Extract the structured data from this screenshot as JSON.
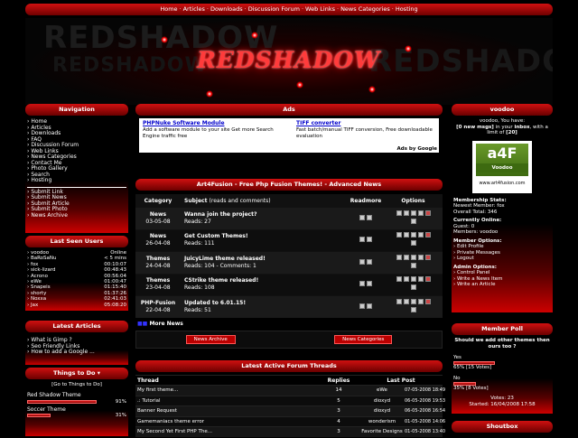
{
  "topnav": [
    "Home",
    "Articles",
    "Downloads",
    "Discussion Forum",
    "Web Links",
    "News Categories",
    "Hosting"
  ],
  "banner": {
    "logo": "REDSHADOW",
    "ghost1": "REDSHADOW",
    "ghost2": "REDSHADOW"
  },
  "navigation": {
    "title": "Navigation",
    "items": [
      "Home",
      "Articles",
      "Downloads",
      "FAQ",
      "Discussion Forum",
      "Web Links",
      "News Categories",
      "Contact Me",
      "Photo Gallery",
      "Search",
      "Hosting"
    ],
    "items2": [
      "Submit Link",
      "Submit News",
      "Submit Article",
      "Submit Photo",
      "News Archive"
    ]
  },
  "lastseen": {
    "title": "Last Seen Users",
    "users": [
      [
        "voodoo",
        "Online"
      ],
      [
        "BaRoSaNu",
        "< 5 mins"
      ],
      [
        "fox",
        "00:10:07"
      ],
      [
        "sick-lizard",
        "00:48:43"
      ],
      [
        "Acrono",
        "00:56:04"
      ],
      [
        "eWe",
        "01:00:47"
      ],
      [
        "Snapeis",
        "01:15:40"
      ],
      [
        "shorty",
        "01:37:26"
      ],
      [
        "Noxxa",
        "02:41:03"
      ],
      [
        "Jax",
        "05:08:20"
      ]
    ]
  },
  "latest_articles": {
    "title": "Latest Articles",
    "items": [
      "What is Gimp ?",
      "Seo Friendly Links",
      "How to add a Google ..."
    ]
  },
  "todo": {
    "title": "Things to Do",
    "link": "[Go to Things to Do]",
    "items": [
      [
        "Red Shadow Theme",
        "91%"
      ],
      [
        "Soccer Theme",
        "31%"
      ]
    ],
    "fills": [
      0.91,
      0.31
    ]
  },
  "ads": {
    "title": "Ads",
    "ad1_title": "PHPNuke Software Module",
    "ad1_text": "Add a software module to your site Get more Search Engine traffic free",
    "ad2_title": "TIFF converter",
    "ad2_text": "Fast batch/manual TIFF conversion, Free downloadable evaluation",
    "adsby": "Ads by Google"
  },
  "news": {
    "title": "Art4Fusion - Free Php Fusion Themes! - Advanced News",
    "headers": {
      "category": "Category",
      "subject": "Subject",
      "subject_sub": "(reads and comments)",
      "readmore": "Readmore",
      "options": "Options"
    },
    "rows": [
      {
        "cat": "News",
        "date": "03-05-08",
        "title": "Wanna join the project?",
        "reads": "Reads: 27"
      },
      {
        "cat": "News",
        "date": "26-04-08",
        "title": "Get Custom Themes!",
        "reads": "Reads: 111"
      },
      {
        "cat": "Themes",
        "date": "24-04-08",
        "title": "JuicyLime theme released!",
        "reads": "Reads: 104 - Comments: 1"
      },
      {
        "cat": "Themes",
        "date": "23-04-08",
        "title": "CStrike theme released!",
        "reads": "Reads: 108"
      },
      {
        "cat": "PHP-Fusion",
        "date": "22-04-08",
        "title": "Updated to 6.01.15!",
        "reads": "Reads: 51"
      }
    ],
    "more": "More News",
    "archive_btn": "News Archive",
    "categories_btn": "News Categories"
  },
  "forum": {
    "title": "Latest Active Forum Threads",
    "headers": {
      "thread": "Thread",
      "replies": "Replies",
      "lastpost": "Last Post"
    },
    "rows": [
      [
        "My first theme...",
        "14",
        "eWe",
        "07-05-2008 18:49"
      ],
      [
        ".: Tutorial",
        "5",
        "dioxyd",
        "06-05-2008 19:53"
      ],
      [
        "Banner Request",
        "3",
        "dioxyd",
        "06-05-2008 16:54"
      ],
      [
        "Gamemaniacs theme error",
        "4",
        "wonderism",
        "01-05-2008 14:06"
      ],
      [
        "My Second Yet First PHP The...",
        "3",
        "Favorite Designs",
        "01-05-2008 13:40"
      ]
    ]
  },
  "user": {
    "title": "voodoo",
    "have_line": "voodoo, You have:",
    "msgs_pre": "[0 new msgs]",
    "msgs_mid": " in your ",
    "inbox": "inbox",
    "msgs_post": ", with a limit of ",
    "limit": "[20]",
    "logo_text": "a4F",
    "logo_sub": "Voodoo",
    "logo_url": "www.art4fusion.com",
    "status_title": "Membership Stats:",
    "newest": "Newest Member: fox",
    "overall": "Overall Total: 346",
    "online_title": "Currently Online:",
    "guest": "Guest: 0",
    "members": "Members: voodoo",
    "options_title": "Member Options:",
    "opts": [
      "Edit Profile",
      "Private Messages",
      "Logout"
    ],
    "admin_title": "Admin Options:",
    "admin": [
      "Control Panel",
      "Write a News Item",
      "Write an Article"
    ]
  },
  "poll": {
    "title": "Member Poll",
    "question": "Should we add other themes then ours too ?",
    "opt1": "Yes",
    "opt1_result": "65% [15 Votes]",
    "opt1_fill": 0.65,
    "opt2": "No",
    "opt2_result": "35% [8 Votes]",
    "opt2_fill": 0.35,
    "votes": "Votes: 23",
    "started": "Started: 16/04/2008 17:58"
  },
  "shoutbox": {
    "title": "Shoutbox"
  }
}
